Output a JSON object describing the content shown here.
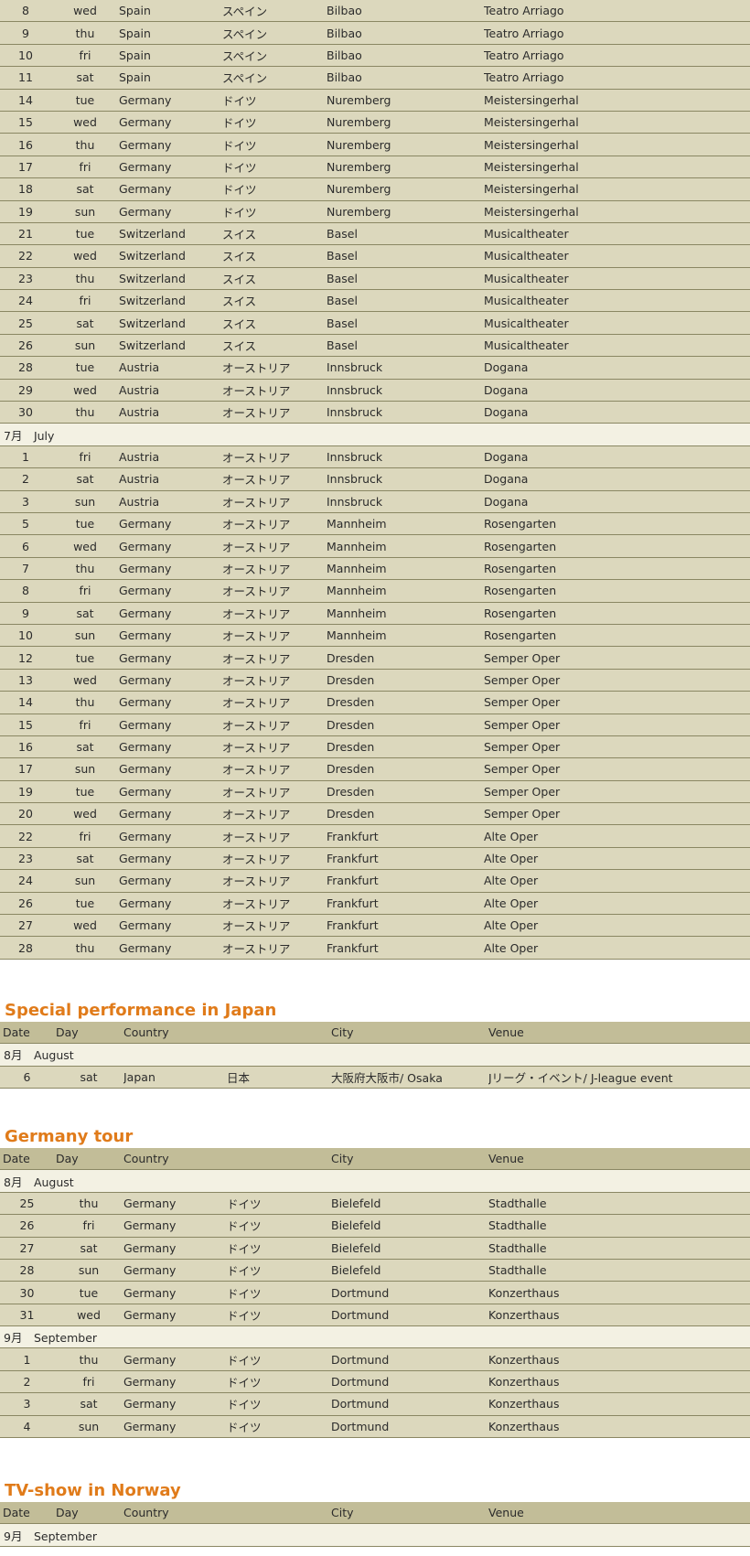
{
  "top_rows": [
    [
      "8",
      "wed",
      "Spain",
      "スペイン",
      "Bilbao",
      "Teatro Arriago"
    ],
    [
      "9",
      "thu",
      "Spain",
      "スペイン",
      "Bilbao",
      "Teatro Arriago"
    ],
    [
      "10",
      "fri",
      "Spain",
      "スペイン",
      "Bilbao",
      "Teatro Arriago"
    ],
    [
      "11",
      "sat",
      "Spain",
      "スペイン",
      "Bilbao",
      "Teatro Arriago"
    ],
    [
      "14",
      "tue",
      "Germany",
      "ドイツ",
      "Nuremberg",
      "Meistersingerhal"
    ],
    [
      "15",
      "wed",
      "Germany",
      "ドイツ",
      "Nuremberg",
      "Meistersingerhal"
    ],
    [
      "16",
      "thu",
      "Germany",
      "ドイツ",
      "Nuremberg",
      "Meistersingerhal"
    ],
    [
      "17",
      "fri",
      "Germany",
      "ドイツ",
      "Nuremberg",
      "Meistersingerhal"
    ],
    [
      "18",
      "sat",
      "Germany",
      "ドイツ",
      "Nuremberg",
      "Meistersingerhal"
    ],
    [
      "19",
      "sun",
      "Germany",
      "ドイツ",
      "Nuremberg",
      "Meistersingerhal"
    ],
    [
      "21",
      "tue",
      "Switzerland",
      "スイス",
      "Basel",
      "Musicaltheater"
    ],
    [
      "22",
      "wed",
      "Switzerland",
      "スイス",
      "Basel",
      "Musicaltheater"
    ],
    [
      "23",
      "thu",
      "Switzerland",
      "スイス",
      "Basel",
      "Musicaltheater"
    ],
    [
      "24",
      "fri",
      "Switzerland",
      "スイス",
      "Basel",
      "Musicaltheater"
    ],
    [
      "25",
      "sat",
      "Switzerland",
      "スイス",
      "Basel",
      "Musicaltheater"
    ],
    [
      "26",
      "sun",
      "Switzerland",
      "スイス",
      "Basel",
      "Musicaltheater"
    ],
    [
      "28",
      "tue",
      "Austria",
      "オーストリア",
      "Innsbruck",
      "Dogana"
    ],
    [
      "29",
      "wed",
      "Austria",
      "オーストリア",
      "Innsbruck",
      "Dogana"
    ],
    [
      "30",
      "thu",
      "Austria",
      "オーストリア",
      "Innsbruck",
      "Dogana"
    ]
  ],
  "july_label": "7月　July",
  "july_rows": [
    [
      "1",
      "fri",
      "Austria",
      "オーストリア",
      "Innsbruck",
      "Dogana"
    ],
    [
      "2",
      "sat",
      "Austria",
      "オーストリア",
      "Innsbruck",
      "Dogana"
    ],
    [
      "3",
      "sun",
      "Austria",
      "オーストリア",
      "Innsbruck",
      "Dogana"
    ],
    [
      "5",
      "tue",
      "Germany",
      "オーストリア",
      "Mannheim",
      "Rosengarten"
    ],
    [
      "6",
      "wed",
      "Germany",
      "オーストリア",
      "Mannheim",
      "Rosengarten"
    ],
    [
      "7",
      "thu",
      "Germany",
      "オーストリア",
      "Mannheim",
      "Rosengarten"
    ],
    [
      "8",
      "fri",
      "Germany",
      "オーストリア",
      "Mannheim",
      "Rosengarten"
    ],
    [
      "9",
      "sat",
      "Germany",
      "オーストリア",
      "Mannheim",
      "Rosengarten"
    ],
    [
      "10",
      "sun",
      "Germany",
      "オーストリア",
      "Mannheim",
      "Rosengarten"
    ],
    [
      "12",
      "tue",
      "Germany",
      "オーストリア",
      "Dresden",
      "Semper Oper"
    ],
    [
      "13",
      "wed",
      "Germany",
      "オーストリア",
      "Dresden",
      "Semper Oper"
    ],
    [
      "14",
      "thu",
      "Germany",
      "オーストリア",
      "Dresden",
      "Semper Oper"
    ],
    [
      "15",
      "fri",
      "Germany",
      "オーストリア",
      "Dresden",
      "Semper Oper"
    ],
    [
      "16",
      "sat",
      "Germany",
      "オーストリア",
      "Dresden",
      "Semper Oper"
    ],
    [
      "17",
      "sun",
      "Germany",
      "オーストリア",
      "Dresden",
      "Semper Oper"
    ],
    [
      "19",
      "tue",
      "Germany",
      "オーストリア",
      "Dresden",
      "Semper Oper"
    ],
    [
      "20",
      "wed",
      "Germany",
      "オーストリア",
      "Dresden",
      "Semper Oper"
    ],
    [
      "22",
      "fri",
      "Germany",
      "オーストリア",
      "Frankfurt",
      "Alte Oper"
    ],
    [
      "23",
      "sat",
      "Germany",
      "オーストリア",
      "Frankfurt",
      "Alte Oper"
    ],
    [
      "24",
      "sun",
      "Germany",
      "オーストリア",
      "Frankfurt",
      "Alte Oper"
    ],
    [
      "26",
      "tue",
      "Germany",
      "オーストリア",
      "Frankfurt",
      "Alte Oper"
    ],
    [
      "27",
      "wed",
      "Germany",
      "オーストリア",
      "Frankfurt",
      "Alte Oper"
    ],
    [
      "28",
      "thu",
      "Germany",
      "オーストリア",
      "Frankfurt",
      "Alte Oper"
    ]
  ],
  "header": [
    "Date",
    "Day",
    "Country",
    "",
    "City",
    "Venue"
  ],
  "japan": {
    "title": "Special performance in Japan",
    "month_label": "8月　August",
    "rows": [
      [
        "6",
        "sat",
        "Japan",
        "日本",
        "大阪府大阪市/ Osaka",
        "Jリーグ・イベント/ J-league event"
      ]
    ]
  },
  "germany": {
    "title": "Germany tour",
    "aug_label": "8月　August",
    "aug_rows": [
      [
        "25",
        "thu",
        "Germany",
        "ドイツ",
        "Bielefeld",
        "Stadthalle"
      ],
      [
        "26",
        "fri",
        "Germany",
        "ドイツ",
        "Bielefeld",
        "Stadthalle"
      ],
      [
        "27",
        "sat",
        "Germany",
        "ドイツ",
        "Bielefeld",
        "Stadthalle"
      ],
      [
        "28",
        "sun",
        "Germany",
        "ドイツ",
        "Bielefeld",
        "Stadthalle"
      ],
      [
        "30",
        "tue",
        "Germany",
        "ドイツ",
        "Dortmund",
        "Konzerthaus"
      ],
      [
        "31",
        "wed",
        "Germany",
        "ドイツ",
        "Dortmund",
        "Konzerthaus"
      ]
    ],
    "sep_label": "9月　September",
    "sep_rows": [
      [
        "1",
        "thu",
        "Germany",
        "ドイツ",
        "Dortmund",
        "Konzerthaus"
      ],
      [
        "2",
        "fri",
        "Germany",
        "ドイツ",
        "Dortmund",
        "Konzerthaus"
      ],
      [
        "3",
        "sat",
        "Germany",
        "ドイツ",
        "Dortmund",
        "Konzerthaus"
      ],
      [
        "4",
        "sun",
        "Germany",
        "ドイツ",
        "Dortmund",
        "Konzerthaus"
      ]
    ]
  },
  "norway": {
    "title": "TV-show in Norway",
    "month_label": "9月　September"
  }
}
